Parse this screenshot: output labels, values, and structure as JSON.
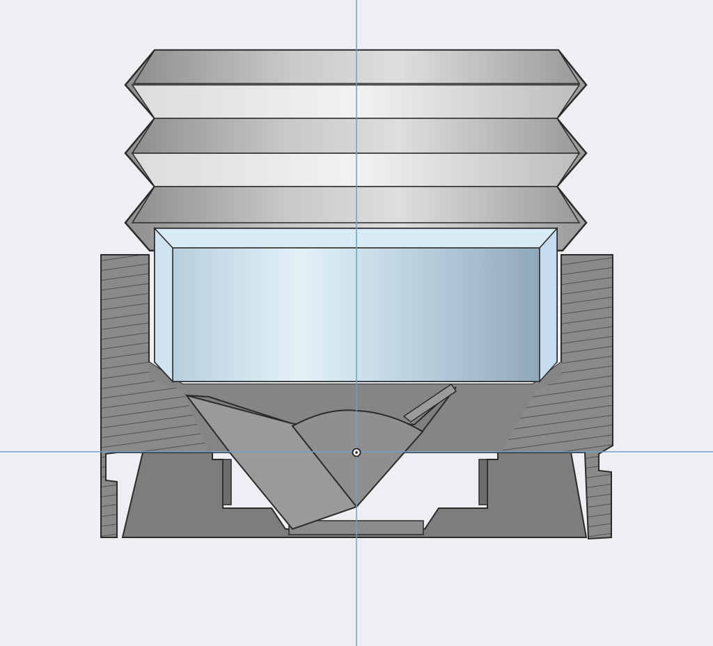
{
  "viewport": {
    "background": "#edeff2",
    "axis_color": "#6e9fcb"
  },
  "model": {
    "section_fill_light": "#8a8a8a",
    "section_fill_dark": "#6f6f6f",
    "section_edge": "#2a2a2a",
    "hatch_color": "#4a4a4a",
    "bellows_light": "#d9d9d9",
    "bellows_dark": "#9a9a9a",
    "insert_light": "#e4f1f8",
    "insert_dark": "#9ab6c8",
    "insert_edge": "#a9cfe6"
  },
  "icons": [
    "origin-point-icon"
  ]
}
